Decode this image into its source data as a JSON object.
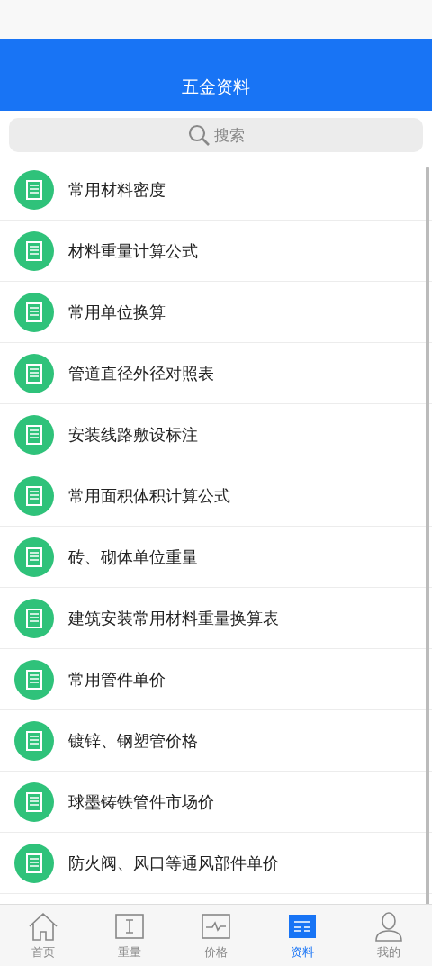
{
  "header": {
    "title": "五金资料"
  },
  "search": {
    "placeholder": "搜索"
  },
  "items": [
    "常用材料密度",
    "材料重量计算公式",
    "常用单位换算",
    "管道直径外径对照表",
    "安装线路敷设标注",
    "常用面积体积计算公式",
    "砖、砌体单位重量",
    "建筑安装常用材料重量换算表",
    "常用管件单价",
    "镀锌、钢塑管价格",
    "球墨铸铁管件市场价",
    "防火阀、风口等通风部件单价"
  ],
  "tabs": [
    {
      "label": "首页",
      "kind": "home",
      "selected": false
    },
    {
      "label": "重量",
      "kind": "weight",
      "selected": false
    },
    {
      "label": "价格",
      "kind": "price",
      "selected": false
    },
    {
      "label": "资料",
      "kind": "docs",
      "selected": true
    },
    {
      "label": "我的",
      "kind": "me",
      "selected": false
    }
  ]
}
